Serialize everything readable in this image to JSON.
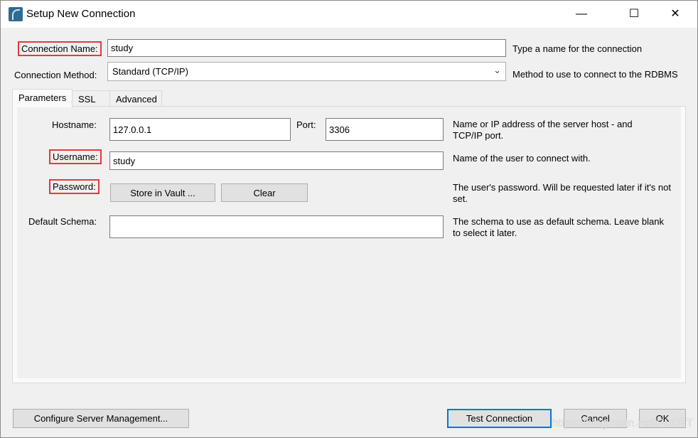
{
  "window": {
    "title": "Setup New Connection",
    "minimize": "—",
    "maximize": "☐",
    "close": "✕"
  },
  "form": {
    "connection_name_label": "Connection Name:",
    "connection_name_value": "study",
    "connection_name_help": "Type a name for the connection",
    "connection_method_label": "Connection Method:",
    "connection_method_value": "Standard (TCP/IP)",
    "connection_method_help": "Method to use to connect to the RDBMS"
  },
  "tabs": [
    {
      "label": "Parameters",
      "active": true
    },
    {
      "label": "SSL"
    },
    {
      "label": "Advanced"
    }
  ],
  "parameters": {
    "hostname_label": "Hostname:",
    "hostname_value": "127.0.0.1",
    "port_label": "Port:",
    "port_value": "3306",
    "hostname_help": "Name or IP address of the server host - and TCP/IP port.",
    "username_label": "Username:",
    "username_value": "study",
    "username_help": "Name of the user to connect with.",
    "password_label": "Password:",
    "store_vault": "Store in Vault ...",
    "clear": "Clear",
    "password_help": "The user's password. Will be requested later if it's not set.",
    "schema_label": "Default Schema:",
    "schema_value": "",
    "schema_help": "The schema to use as default schema. Leave blank to select it later."
  },
  "footer": {
    "configure": "Configure Server Management...",
    "test": "Test Connection",
    "cancel": "Cancel",
    "ok": "OK"
  },
  "watermark": "https://blog.csdn.net/PLCET",
  "colors": {
    "highlight": "#e8383d",
    "default_button": "#0078d7"
  }
}
